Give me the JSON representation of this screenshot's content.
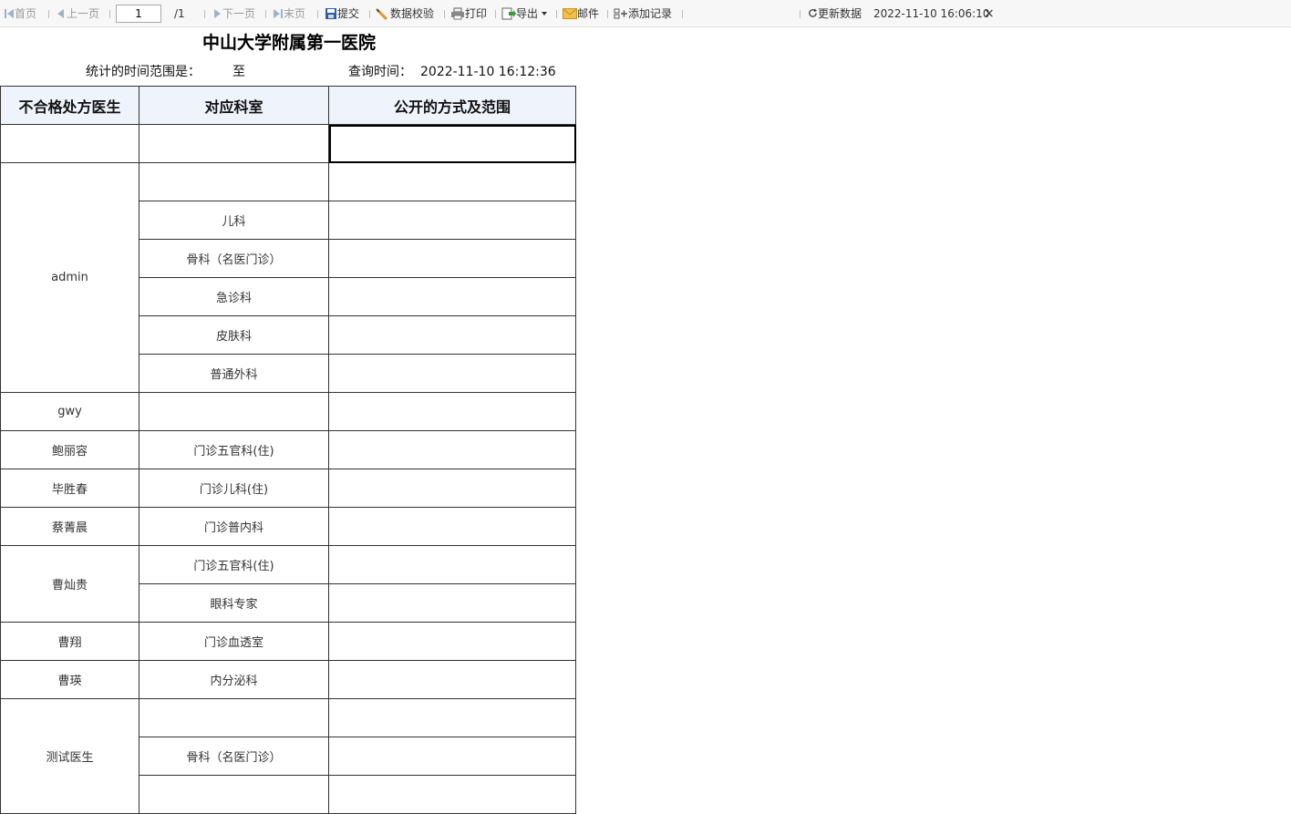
{
  "toolbar": {
    "first": "首页",
    "prev": "上一页",
    "page_value": "1",
    "page_total": "/1",
    "next": "下一页",
    "last": "末页",
    "submit": "提交",
    "validate": "数据校验",
    "print": "打印",
    "export": "导出",
    "mail": "邮件",
    "add_record": "添加记录",
    "refresh": "更新数据",
    "refresh_time": "2022-11-10 16:06:10",
    "close": "×"
  },
  "report": {
    "title": "中山大学附属第一医院",
    "range_label": "统计的时间范围是：",
    "range_to": "至",
    "query_label": "查询时间：",
    "query_time": "2022-11-10  16:12:36",
    "headers": [
      "不合格处方医生",
      "对应科室",
      "公开的方式及范围"
    ],
    "groups": [
      {
        "doctor": "",
        "departments": [
          ""
        ]
      },
      {
        "doctor": "admin",
        "departments": [
          "",
          "儿科",
          "骨科（名医门诊）",
          "急诊科",
          "皮肤科",
          "普通外科"
        ]
      },
      {
        "doctor": "gwy",
        "departments": [
          ""
        ]
      },
      {
        "doctor": "鲍丽容",
        "departments": [
          "门诊五官科(住)"
        ]
      },
      {
        "doctor": "毕胜春",
        "departments": [
          "门诊儿科(住)"
        ]
      },
      {
        "doctor": "蔡菁晨",
        "departments": [
          "门诊普内科"
        ]
      },
      {
        "doctor": "曹灿贵",
        "departments": [
          "门诊五官科(住)",
          "眼科专家"
        ]
      },
      {
        "doctor": "曹翔",
        "departments": [
          "门诊血透室"
        ]
      },
      {
        "doctor": "曹瑛",
        "departments": [
          "内分泌科"
        ]
      },
      {
        "doctor": "测试医生",
        "departments": [
          "",
          "骨科（名医门诊）",
          ""
        ]
      }
    ]
  }
}
